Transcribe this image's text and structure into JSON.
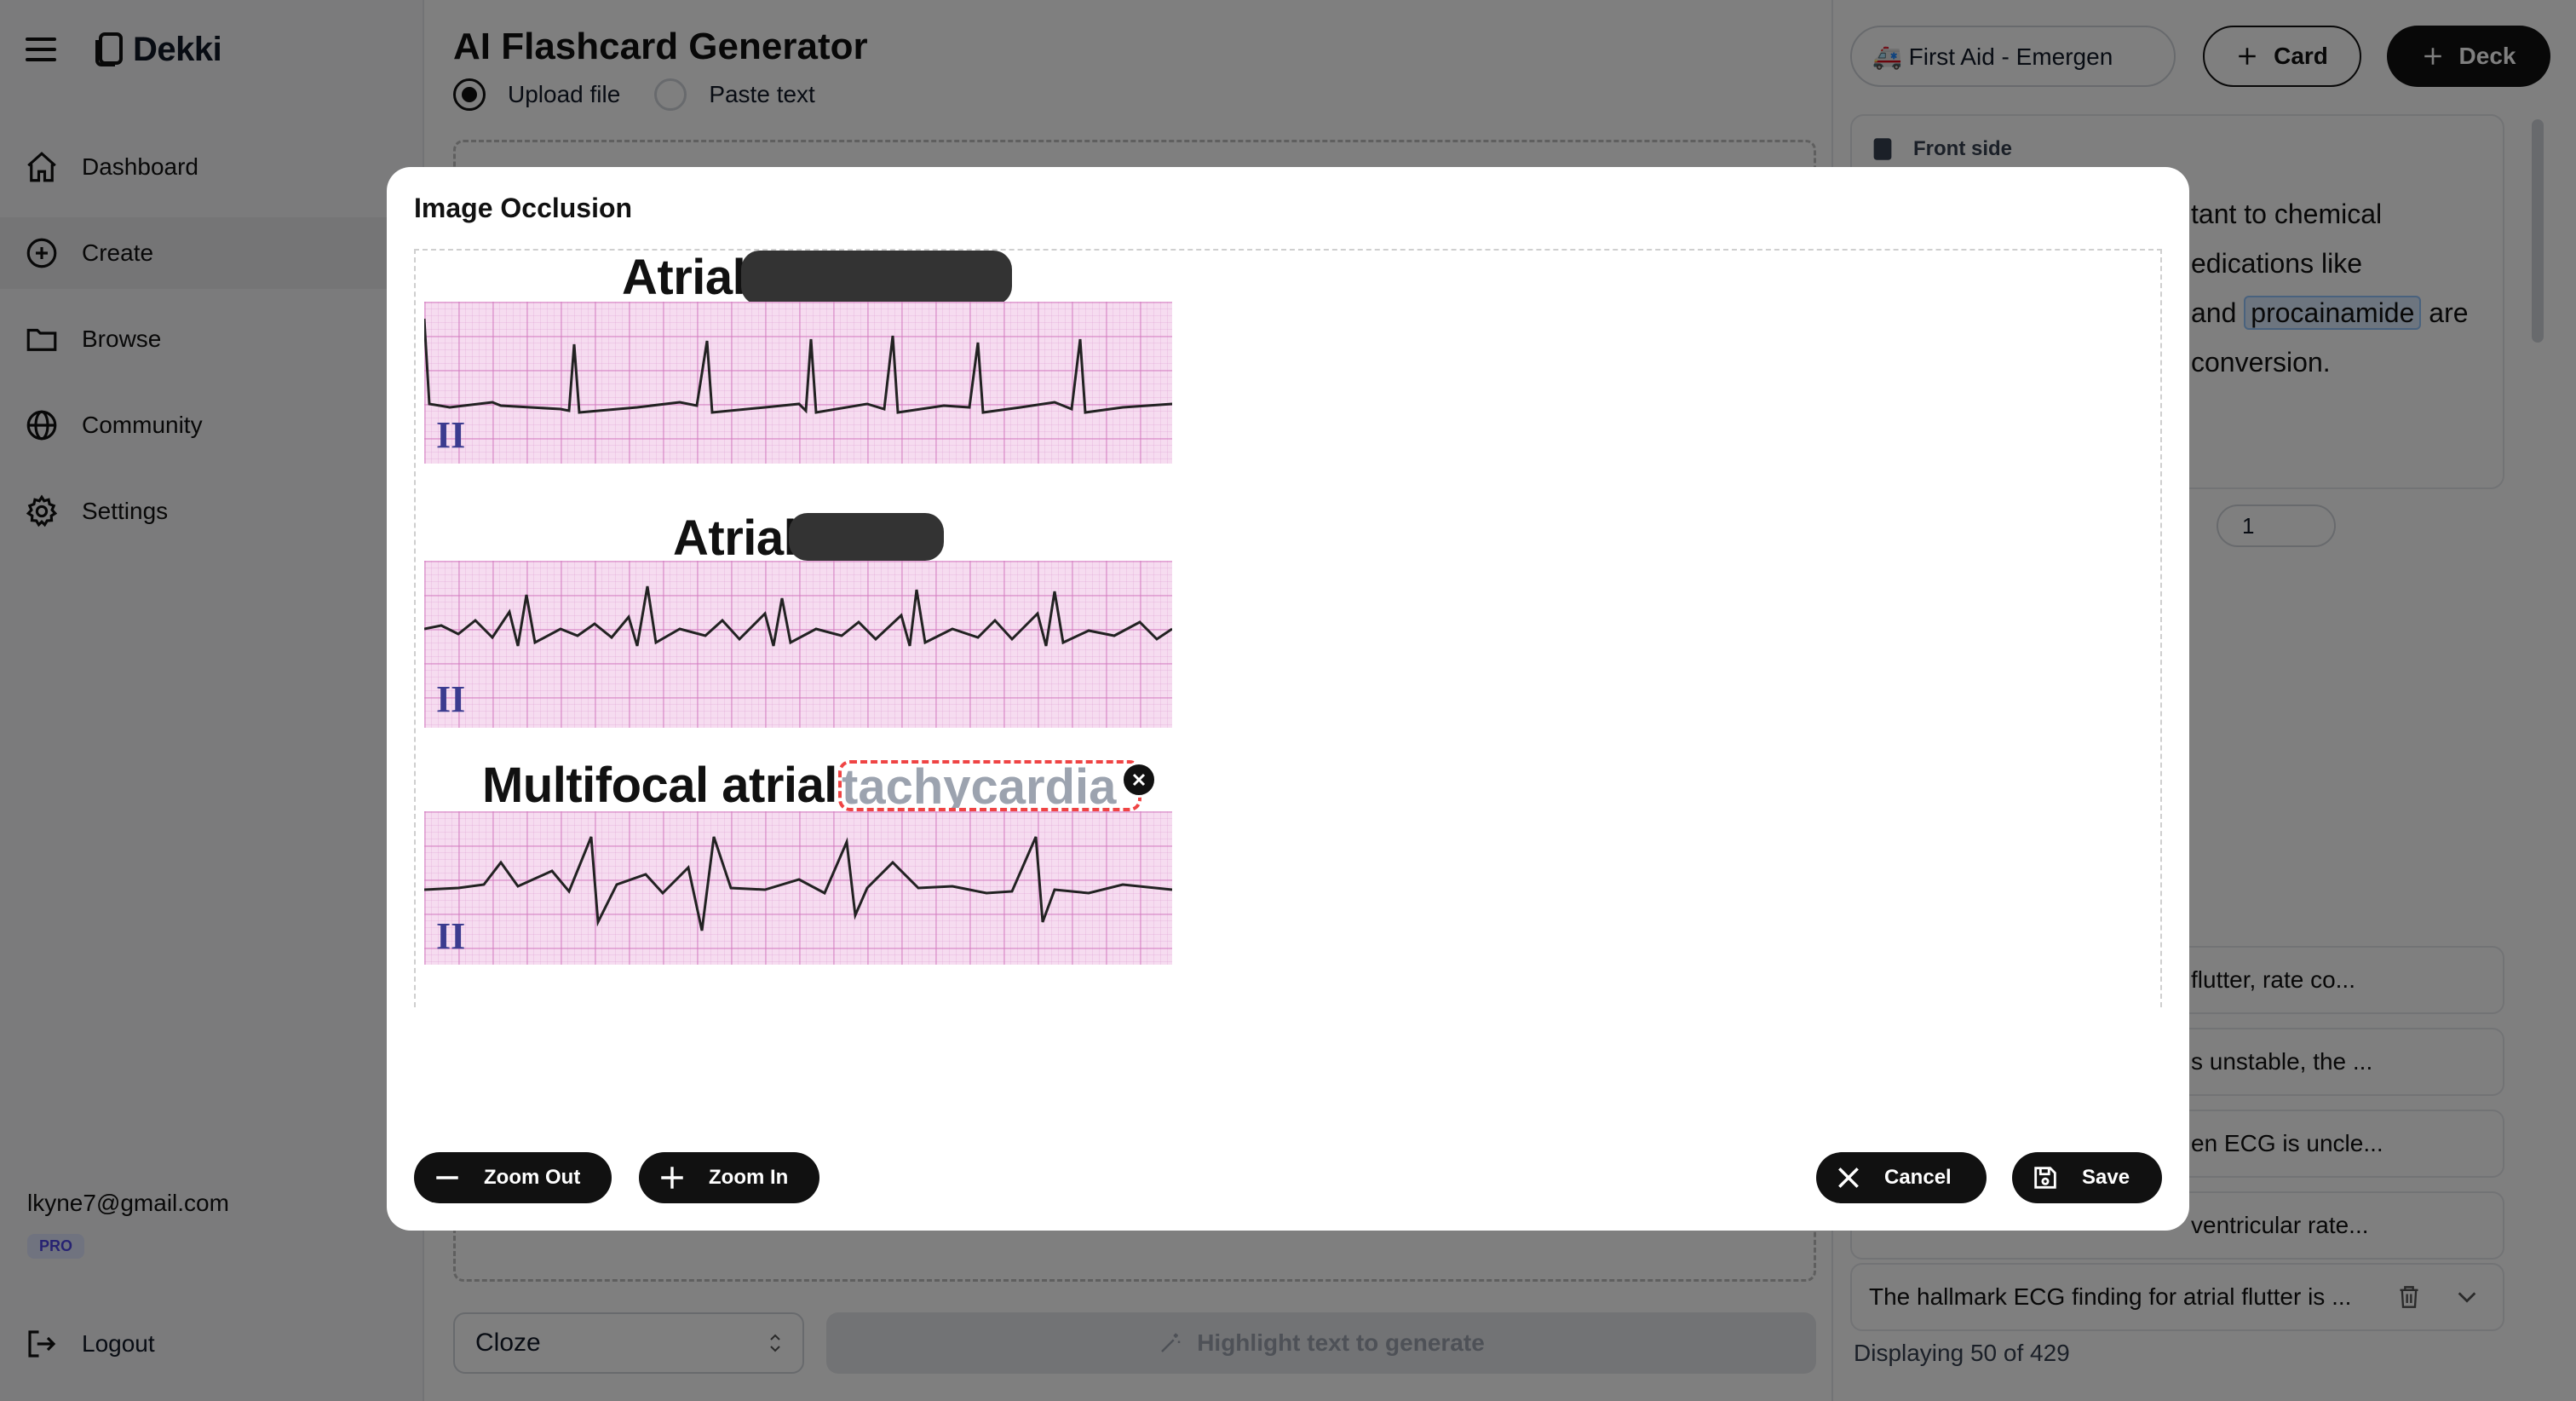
{
  "app": {
    "name": "Dekki"
  },
  "sidebar": {
    "items": [
      {
        "label": "Dashboard",
        "icon": "home-icon"
      },
      {
        "label": "Create",
        "icon": "plus-circle-icon",
        "active": true
      },
      {
        "label": "Browse",
        "icon": "folder-icon"
      },
      {
        "label": "Community",
        "icon": "globe-icon"
      },
      {
        "label": "Settings",
        "icon": "gear-icon"
      }
    ],
    "email": "lkyne7@gmail.com",
    "plan_badge": "PRO",
    "logout_label": "Logout"
  },
  "main": {
    "title": "AI Flashcard Generator",
    "source_options": [
      {
        "label": "Upload file",
        "selected": true
      },
      {
        "label": "Paste text",
        "selected": false
      }
    ],
    "card_type": "Cloze",
    "generate_label": "Highlight text to generate"
  },
  "right_panel": {
    "deck_select": "🚑 First Aid - Emergen",
    "add_card_label": "Card",
    "add_deck_label": "Deck",
    "front_label": "Front side",
    "front_text_lines": [
      "tant to chemical",
      "edications like"
    ],
    "front_text_and": "and ",
    "front_highlight": "procainamide",
    "front_text_are": " are",
    "front_text_last": "conversion.",
    "mini_select_value": "1",
    "cards": [
      "flutter, rate co...",
      "s unstable, the ...",
      "en ECG is uncle...",
      "ventricular rate...",
      "The hallmark ECG finding for atrial flutter is ..."
    ],
    "displaying": "Displaying 50 of 429"
  },
  "modal": {
    "title": "Image Occlusion",
    "labels": {
      "first": "Atrial",
      "second": "Atrial",
      "third": "Multifocal atrial"
    },
    "occlusion_text": "tachycardia",
    "lead_label": "II",
    "zoom_out_label": "Zoom Out",
    "zoom_in_label": "Zoom In",
    "cancel_label": "Cancel",
    "save_label": "Save"
  }
}
